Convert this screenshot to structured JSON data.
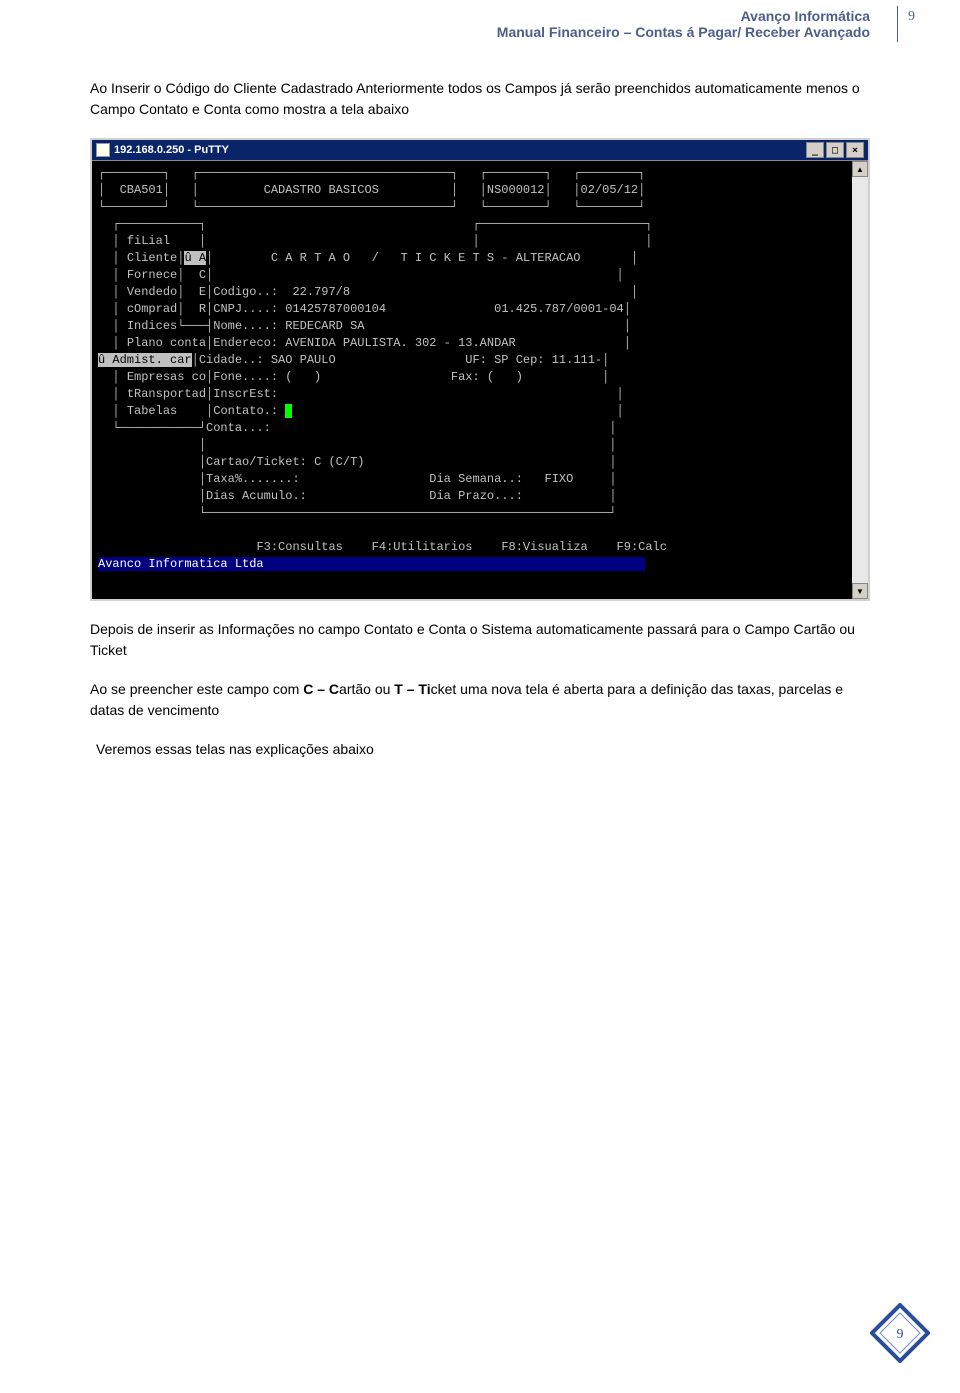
{
  "header": {
    "company": "Avanço Informática",
    "manual": "Manual Financeiro – Contas á Pagar/ Receber Avançado",
    "page_num": "9"
  },
  "body": {
    "para1": "Ao Inserir o Código do Cliente Cadastrado Anteriormente todos os Campos já serão preenchidos automaticamente menos o Campo Contato e Conta como mostra a tela abaixo",
    "para2": "Depois de inserir as Informações no campo Contato e Conta o Sistema automaticamente passará para o Campo Cartão ou Ticket",
    "para3_pre": "Ao se preencher este campo com ",
    "para3_b1": "C – C",
    "para3_mid1": "artão ou ",
    "para3_b2": "T – Ti",
    "para3_mid2": "cket uma nova tela é aberta para a definição das taxas, parcelas e datas de vencimento",
    "para4": "Veremos essas telas nas explicações abaixo"
  },
  "putty": {
    "title": "192.168.0.250 - PuTTY",
    "min": "_",
    "max": "□",
    "close": "×",
    "sb_up": "▲",
    "sb_down": "▼"
  },
  "terminal": {
    "row1_code": "  CBA501",
    "row1_title": "CADASTRO BASICOS",
    "row1_ns": "NS000012",
    "row1_date": "02/05/12",
    "left_menu": {
      "filial": "fiLial",
      "cliente": "Cliente",
      "fornece": "Fornece",
      "vendedo": "Vendedo",
      "comprad": "cOmprad",
      "indices": "Indices",
      "plano": "Plano conta",
      "admist": "û Admist. car",
      "empresas": "Empresas co",
      "transport": "tRansportad",
      "tabelas": "Tabelas"
    },
    "col2": {
      "a": "û A",
      "c": "C",
      "e": "E",
      "r": "R"
    },
    "form": {
      "header": "C A R T A O   /   T I C K E T S - ALTERACAO",
      "codigo_lbl": "Codigo..:",
      "codigo_val": "22.797/8",
      "cnpj_lbl": "CNPJ....:",
      "cnpj_val": "01425787000104",
      "cnpj_fmt": "01.425.787/0001-04",
      "nome_lbl": "Nome....:",
      "nome_val": "REDECARD SA",
      "endereco_lbl": "Endereco:",
      "endereco_val": "AVENIDA PAULISTA. 302 - 13.ANDAR",
      "cidade_lbl": "Cidade..:",
      "cidade_val": "SAO PAULO",
      "uf_lbl": "UF:",
      "uf_val": "SP",
      "cep_lbl": "Cep:",
      "cep_val": "11.111-",
      "fone_lbl": "Fone....:",
      "fone_val": "(   )",
      "fax_lbl": "Fax:",
      "fax_val": "(   )",
      "inscr_lbl": "InscrEst:",
      "contato_lbl": "Contato.:",
      "conta_lbl": "Conta...:",
      "cartao_lbl": "Cartao/Ticket:",
      "cartao_val": "C",
      "cartao_hint": "(C/T)",
      "taxa_lbl": "Taxa%.......:",
      "dia_semana_lbl": "Dia Semana..:",
      "dia_semana_val": "FIXO",
      "dias_acum_lbl": "Dias Acumulo.:",
      "dia_prazo_lbl": "Dia Prazo...:"
    },
    "fkeys": {
      "f3": "F3:Consultas",
      "f4": "F4:Utilitarios",
      "f8": "F8:Visualiza",
      "f9": "F9:Calc"
    },
    "status": "Avanco Informatica Ltda"
  },
  "footer": {
    "page": "9"
  }
}
